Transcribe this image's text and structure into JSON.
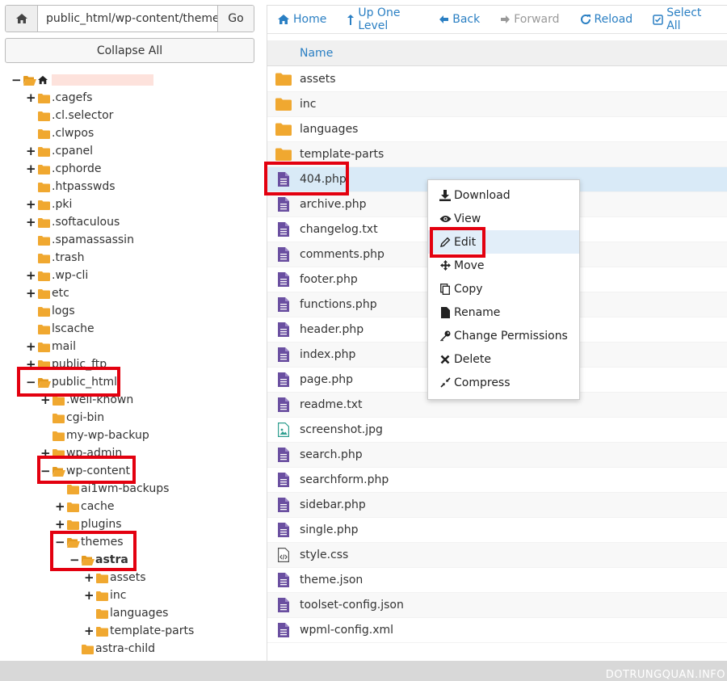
{
  "pathbar": {
    "path_value": "public_html/wp-content/theme",
    "go_label": "Go"
  },
  "collapse_label": "Collapse All",
  "tree": [
    {
      "label": "",
      "tog": "−",
      "open": true,
      "home": true,
      "blur": true
    },
    {
      "label": ".cagefs",
      "tog": "+"
    },
    {
      "label": ".cl.selector",
      "tog": ""
    },
    {
      "label": ".clwpos",
      "tog": ""
    },
    {
      "label": ".cpanel",
      "tog": "+"
    },
    {
      "label": ".cphorde",
      "tog": "+"
    },
    {
      "label": ".htpasswds",
      "tog": ""
    },
    {
      "label": ".pki",
      "tog": "+"
    },
    {
      "label": ".softaculous",
      "tog": "+"
    },
    {
      "label": ".spamassassin",
      "tog": ""
    },
    {
      "label": ".trash",
      "tog": ""
    },
    {
      "label": ".wp-cli",
      "tog": "+"
    },
    {
      "label": "etc",
      "tog": "+"
    },
    {
      "label": "logs",
      "tog": ""
    },
    {
      "label": "lscache",
      "tog": ""
    },
    {
      "label": "mail",
      "tog": "+"
    },
    {
      "label": "public_ftp",
      "tog": "+"
    },
    {
      "label": "public_html",
      "tog": "−",
      "open": true
    },
    {
      "label": ".well-known",
      "tog": "+"
    },
    {
      "label": "cgi-bin",
      "tog": ""
    },
    {
      "label": "my-wp-backup",
      "tog": ""
    },
    {
      "label": "wp-admin",
      "tog": "+"
    },
    {
      "label": "wp-content",
      "tog": "−",
      "open": true
    },
    {
      "label": "ai1wm-backups",
      "tog": ""
    },
    {
      "label": "cache",
      "tog": "+"
    },
    {
      "label": "plugins",
      "tog": "+"
    },
    {
      "label": "themes",
      "tog": "−",
      "open": true
    },
    {
      "label": "astra",
      "tog": "−",
      "open": true,
      "bold": true
    },
    {
      "label": "assets",
      "tog": "+"
    },
    {
      "label": "inc",
      "tog": "+"
    },
    {
      "label": "languages",
      "tog": ""
    },
    {
      "label": "template-parts",
      "tog": "+"
    },
    {
      "label": "astra-child",
      "tog": ""
    }
  ],
  "toolbar": {
    "home": "Home",
    "up": "Up One Level",
    "back": "Back",
    "forward": "Forward",
    "reload": "Reload",
    "select_all": "Select All"
  },
  "table_header": "Name",
  "files": [
    {
      "name": "assets",
      "type": "folder"
    },
    {
      "name": "inc",
      "type": "folder"
    },
    {
      "name": "languages",
      "type": "folder"
    },
    {
      "name": "template-parts",
      "type": "folder"
    },
    {
      "name": "404.php",
      "type": "file",
      "selected": true
    },
    {
      "name": "archive.php",
      "type": "file"
    },
    {
      "name": "changelog.txt",
      "type": "file"
    },
    {
      "name": "comments.php",
      "type": "file"
    },
    {
      "name": "footer.php",
      "type": "file"
    },
    {
      "name": "functions.php",
      "type": "file"
    },
    {
      "name": "header.php",
      "type": "file"
    },
    {
      "name": "index.php",
      "type": "file"
    },
    {
      "name": "page.php",
      "type": "file"
    },
    {
      "name": "readme.txt",
      "type": "file"
    },
    {
      "name": "screenshot.jpg",
      "type": "image"
    },
    {
      "name": "search.php",
      "type": "file"
    },
    {
      "name": "searchform.php",
      "type": "file"
    },
    {
      "name": "sidebar.php",
      "type": "file"
    },
    {
      "name": "single.php",
      "type": "file"
    },
    {
      "name": "style.css",
      "type": "code"
    },
    {
      "name": "theme.json",
      "type": "file"
    },
    {
      "name": "toolset-config.json",
      "type": "file"
    },
    {
      "name": "wpml-config.xml",
      "type": "file"
    }
  ],
  "context_menu": [
    {
      "label": "Download",
      "icon": "download-icon"
    },
    {
      "label": "View",
      "icon": "eye-icon"
    },
    {
      "label": "Edit",
      "icon": "pencil-icon",
      "highlight": true
    },
    {
      "label": "Move",
      "icon": "move-icon"
    },
    {
      "label": "Copy",
      "icon": "copy-icon"
    },
    {
      "label": "Rename",
      "icon": "file-icon"
    },
    {
      "label": "Change Permissions",
      "icon": "key-icon"
    },
    {
      "label": "Delete",
      "icon": "delete-icon"
    },
    {
      "label": "Compress",
      "icon": "compress-icon"
    }
  ],
  "watermark": "DOTRUNGQUAN.INFO",
  "colors": {
    "accent": "#2a7fc3",
    "folder": "#f0a830",
    "file": "#6a4fa0",
    "highlight": "#e3000f",
    "selected_row": "#d9eaf7"
  }
}
